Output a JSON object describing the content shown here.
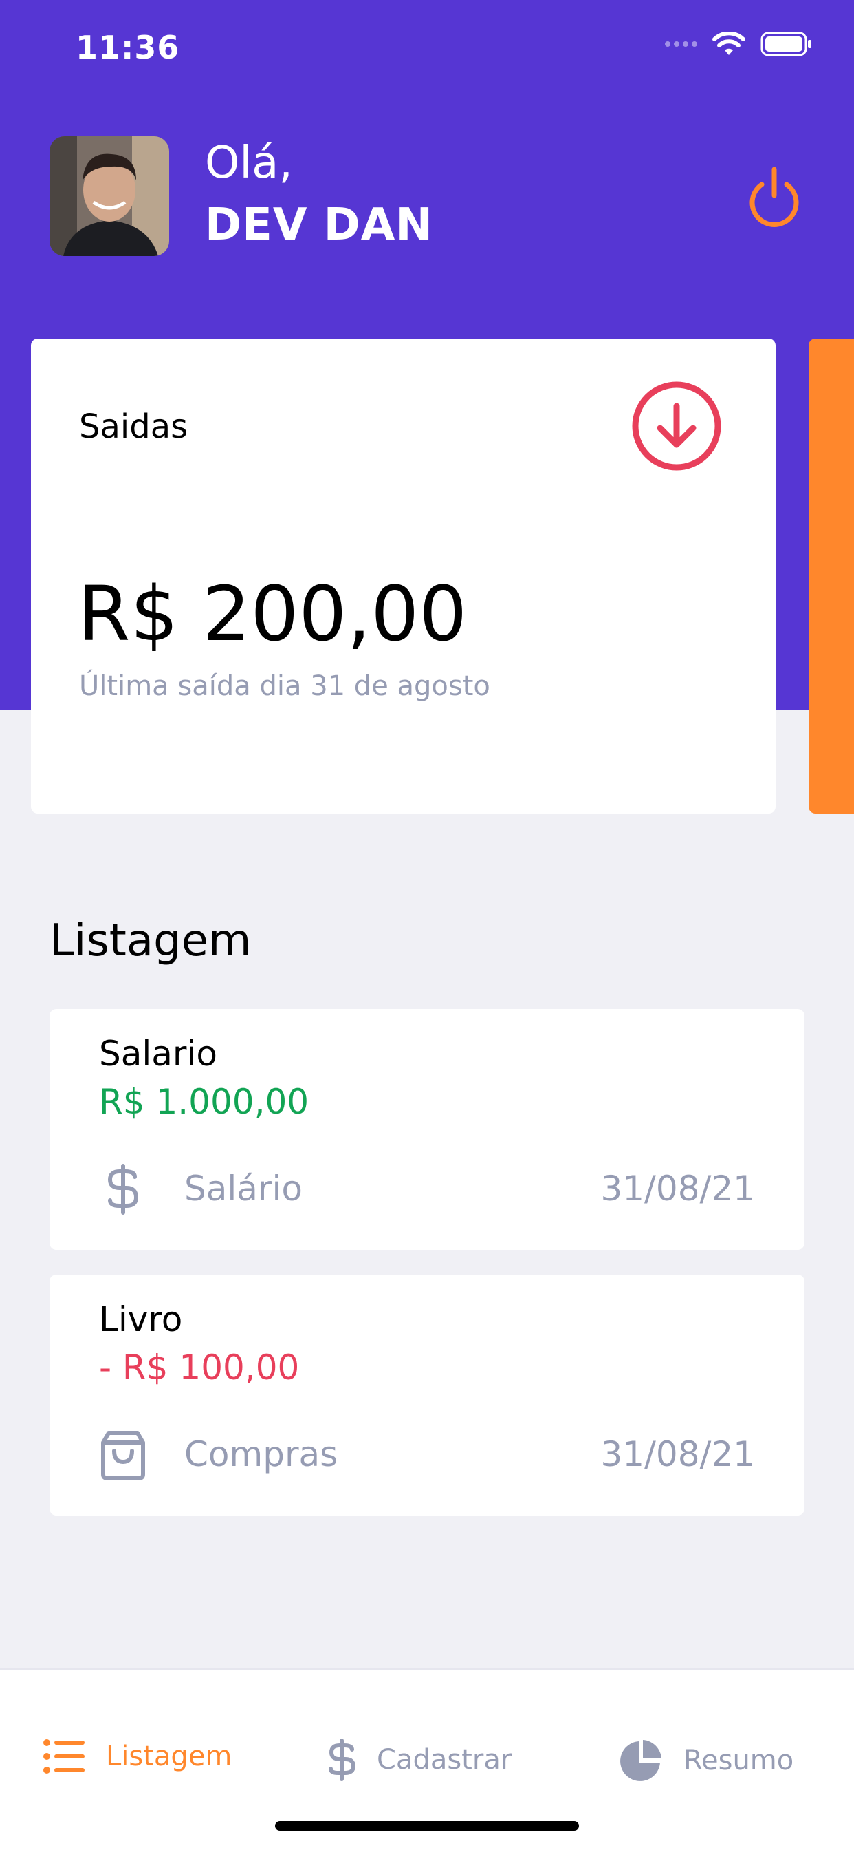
{
  "status_bar": {
    "time": "11:36",
    "icons": [
      "signal-icon",
      "wifi-icon",
      "battery-icon"
    ]
  },
  "header": {
    "greeting": "Olá,",
    "user_name": "DEV DAN",
    "logout_icon": "power-icon"
  },
  "highlight_card": {
    "title": "Saidas",
    "icon": "arrow-down-circle-icon",
    "amount": "R$ 200,00",
    "last_transaction": "Última saída dia 31 de agosto"
  },
  "list": {
    "title": "Listagem",
    "transactions": [
      {
        "name": "Salario",
        "amount": "R$ 1.000,00",
        "type": "income",
        "category": "Salário",
        "category_icon": "dollar-sign-icon",
        "date": "31/08/21"
      },
      {
        "name": "Livro",
        "amount": "- R$ 100,00",
        "type": "outcome",
        "category": "Compras",
        "category_icon": "shopping-bag-icon",
        "date": "31/08/21"
      }
    ]
  },
  "tabs": [
    {
      "label": "Listagem",
      "icon": "list-icon",
      "active": true
    },
    {
      "label": "Cadastrar",
      "icon": "dollar-sign-icon",
      "active": false
    },
    {
      "label": "Resumo",
      "icon": "pie-chart-icon",
      "active": false
    }
  ],
  "colors": {
    "primary": "#5636D3",
    "secondary": "#FF872C",
    "success": "#12A454",
    "attention": "#E83F5B",
    "text_light": "#969CB3",
    "background": "#F0F0F5"
  }
}
